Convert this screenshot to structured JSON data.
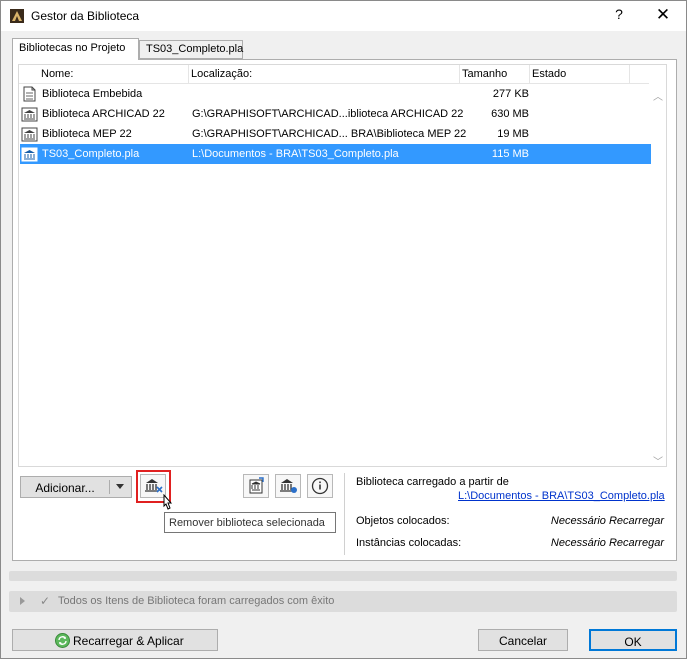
{
  "window": {
    "title": "Gestor da Biblioteca",
    "help_glyph": "?",
    "close_glyph": "✕"
  },
  "tabs": [
    {
      "label": "Bibliotecas no Projeto",
      "active": true
    },
    {
      "label": "TS03_Completo.pla",
      "active": false
    }
  ],
  "table": {
    "columns": [
      "Nome:",
      "Localização:",
      "Tamanho",
      "Estado"
    ],
    "rows": [
      {
        "name": "Biblioteca Embebida",
        "location": "",
        "size": "277 KB",
        "status": "",
        "icon": "embedded-library-icon",
        "selected": false
      },
      {
        "name": "Biblioteca ARCHICAD 22",
        "location": "G:\\GRAPHISOFT\\ARCHICAD...iblioteca ARCHICAD 22",
        "size": "630 MB",
        "status": "",
        "icon": "library-icon",
        "selected": false
      },
      {
        "name": "Biblioteca MEP 22",
        "location": "G:\\GRAPHISOFT\\ARCHICAD... BRA\\Biblioteca MEP 22",
        "size": "19 MB",
        "status": "",
        "icon": "library-icon",
        "selected": false
      },
      {
        "name": "TS03_Completo.pla",
        "location": "L:\\Documentos - BRA\\TS03_Completo.pla",
        "size": "115 MB",
        "status": "",
        "icon": "library-icon",
        "selected": true
      }
    ]
  },
  "toolbar": {
    "add_label": "Adicionar...",
    "remove_tooltip": "Remover biblioteca selecionada"
  },
  "info": {
    "loaded_from_label": "Biblioteca carregado a partir de",
    "loaded_from_path": "L:\\Documentos - BRA\\TS03_Completo.pla",
    "placed_objects_label": "Objetos colocados:",
    "placed_objects_value": "Necessário Recarregar",
    "placed_instances_label": "Instâncias colocadas:",
    "placed_instances_value": "Necessário Recarregar"
  },
  "status": {
    "message": "Todos os Itens de Biblioteca foram carregados com êxito"
  },
  "footer": {
    "reload_label": "Recarregar & Aplicar",
    "cancel_label": "Cancelar",
    "ok_label": "OK"
  },
  "colors": {
    "selection": "#3399ff",
    "highlight_box": "#e02020",
    "link": "#0033cc",
    "ok_border": "#0078d7"
  }
}
